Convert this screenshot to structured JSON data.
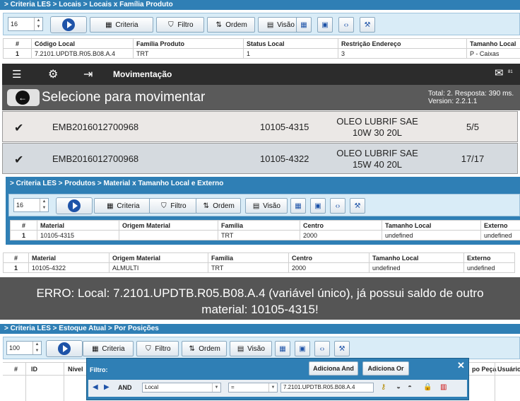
{
  "panel1": {
    "breadcrumb": "> Criteria LES > Locais > Locais x Família Produto",
    "spinner_value": "16",
    "buttons": {
      "criteria": "Criteria",
      "filtro": "Filtro",
      "ordem": "Ordem",
      "visao": "Visão"
    },
    "columns": [
      "#",
      "Código Local",
      "Família Produto",
      "Status Local",
      "Restrição Endereço",
      "Tamanho Local"
    ],
    "rows": [
      [
        "1",
        "7.2101.UPDTB.R05.B08.A.4",
        "TRT",
        "1",
        "3",
        "P - Caixas"
      ]
    ]
  },
  "mobile": {
    "app_title": "Movimentação",
    "badge": "81",
    "heading": "Selecione para movimentar",
    "total": "Total: 2. Resposta: 390 ms.",
    "version": "Version: 2.2.1.1",
    "rows": [
      {
        "code": "EMB2016012700968",
        "material": "10105-4315",
        "desc1": "OLEO LUBRIF SAE",
        "desc2": "10W 30 20L",
        "qty": "5/5"
      },
      {
        "code": "EMB2016012700968",
        "material": "10105-4322",
        "desc1": "OLEO LUBRIF SAE",
        "desc2": "15W 40 20L",
        "qty": "17/17"
      }
    ]
  },
  "panel2": {
    "breadcrumb": "> Criteria LES > Produtos > Material x Tamanho Local e Externo",
    "spinner_value": "16",
    "buttons": {
      "criteria": "Criteria",
      "filtro": "Filtro",
      "ordem": "Ordem",
      "visao": "Visão"
    },
    "columns": [
      "#",
      "Material",
      "Origem Material",
      "Família",
      "Centro",
      "Tamanho Local",
      "Externo"
    ],
    "rows": [
      [
        "1",
        "10105-4315",
        "",
        "TRT",
        "2000",
        "undefined",
        "undefined"
      ]
    ]
  },
  "panel3": {
    "columns": [
      "#",
      "Material",
      "Origem Material",
      "Família",
      "Centro",
      "Tamanho Local",
      "Externo"
    ],
    "rows": [
      [
        "1",
        "10105-4322",
        "ALMULTI",
        "TRT",
        "2000",
        "undefined",
        "undefined"
      ]
    ]
  },
  "error": {
    "line1": "ERRO: Local: 7.2101.UPDTB.R05.B08.A.4 (variável único), já possui saldo de outro",
    "line2": "material: 10105-4315!"
  },
  "panel4": {
    "breadcrumb": "> Criteria LES > Estoque Atual > Por Posições",
    "spinner_value": "100",
    "buttons": {
      "criteria": "Criteria",
      "filtro": "Filtro",
      "ordem": "Ordem",
      "visao": "Visão"
    },
    "columns": {
      "num": "#",
      "id": "ID",
      "nivel": "Nível",
      "peca": "po Peça",
      "usuario": "Usuário"
    },
    "filter_popup": {
      "title": "Filtro:",
      "add_and": "Adiciona And",
      "add_or": "Adiciona Or",
      "operator": "AND",
      "field": "Local",
      "comparator": "=",
      "value": "7.2101.UPDTB.R05.B08.A.4"
    }
  }
}
